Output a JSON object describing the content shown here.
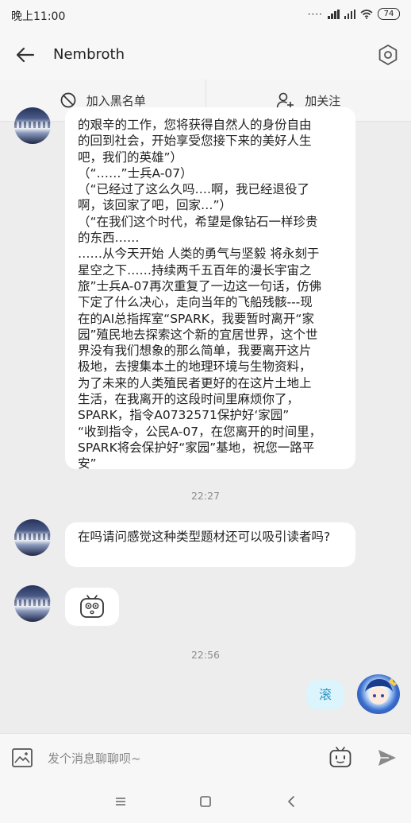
{
  "status_bar": {
    "time": "晚上11:00",
    "battery": "74"
  },
  "header": {
    "title": "Nembroth"
  },
  "actions": {
    "block_label": "加入黑名单",
    "follow_label": "加关注"
  },
  "messages": {
    "long_message_lines": [
      "的艰辛的工作，您将获得自然人的身份自由",
      "的回到社会，开始享受您接下来的美好人生",
      "吧，我们的英雄”）",
      "（“……”士兵A-07）",
      "（“已经过了这么久吗….啊，我已经退役了",
      "啊，该回家了吧，回家…”）",
      "（“在我们这个时代，希望是像钻石一样珍贵",
      "的东西……",
      "……从今天开始 人类的勇气与坚毅 将永刻于",
      "星空之下……持续两千五百年的漫长宇宙之",
      "旅”士兵A-07再次重复了一边这一句话，仿佛",
      "下定了什么决心，走向当年的飞船残骸---现",
      "在的AI总指挥室“SPARK，我要暂时离开“家",
      "园”殖民地去探索这个新的宜居世界，这个世",
      "界没有我们想象的那么简单，我要离开这片",
      "极地，去搜集本土的地理环境与生物资料，",
      "为了未来的人类殖民者更好的在这片土地上",
      "生活，在我离开的这段时间里麻烦你了，",
      "SPARK，指令A0732571保护好‘家园”",
      "“收到指令，公民A-07，在您离开的时间里，",
      "SPARK将会保护好“家园”基地，祝您一路平",
      "安”"
    ],
    "timestamp_1": "22:27",
    "question": "在吗请问感觉这种类型题材还可以吸引读者吗?",
    "timestamp_2": "22:56",
    "my_reply": "滚"
  },
  "input": {
    "placeholder": "发个消息聊聊呗~"
  }
}
